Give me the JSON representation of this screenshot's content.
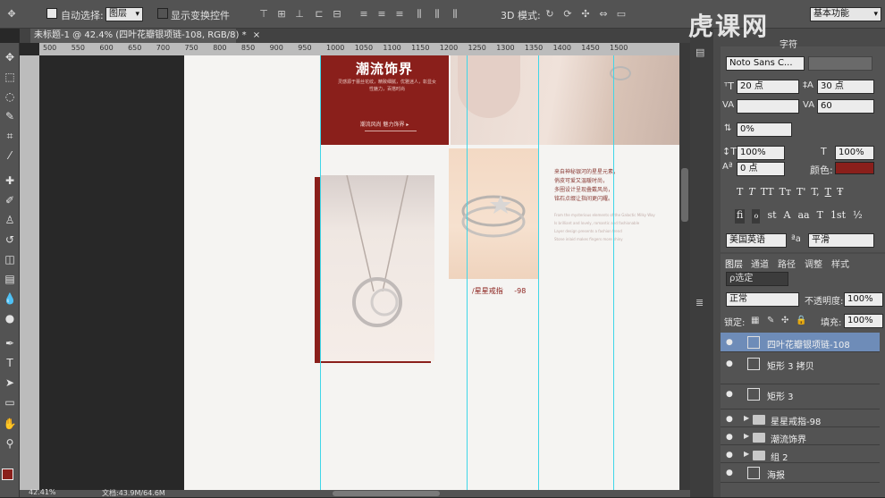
{
  "options_bar": {
    "auto_select_label": "自动选择:",
    "auto_select_value": "图层",
    "show_transform_label": "显示变换控件",
    "mode_3d_label": "3D 模式:",
    "workspace": "基本功能"
  },
  "document": {
    "tab_title": "未标题-1 @ 42.4% (四叶花瓣银项链-108, RGB/8) *",
    "tab_close": "×",
    "ruler_ticks": [
      "500",
      "550",
      "600",
      "650",
      "700",
      "750",
      "800",
      "850",
      "900",
      "950",
      "1000",
      "1050",
      "1100",
      "1150",
      "1200",
      "1250",
      "1300",
      "1350",
      "1400",
      "1450",
      "1500"
    ],
    "status_zoom": "42.41%",
    "status_doc": "文档:43.9M/64.6M"
  },
  "artboard": {
    "banner_title": "潮流饰界",
    "banner_body": "灵感源于蕾丝花纹，精致细腻，优雅迷人，彰显女性魅力，百搭时尚",
    "banner_link": "潮流风尚 魅力饰界 ▸",
    "text_block": [
      "来自神秘银河的星星元素，",
      "俏皮可爱又温暖时尚，",
      "多圈设计呈现叠戴风尚，",
      "铭石点缀让指间更闪耀。"
    ],
    "text_small": [
      "From the mysterious elements of the Galactic Milky Way",
      "Is brilliant and lovely, romantic and fashionable",
      "Layer design presents a fashion trend",
      "Stone inlaid makes fingers more shiny"
    ],
    "product_caption": "/星星戒指",
    "product_price": "-98",
    "colors": {
      "brand_red": "#8a1f1b",
      "guide": "#3fd6e8"
    }
  },
  "character_panel": {
    "tab": "字符",
    "font_family": "Noto Sans C...",
    "font_size": "20 点",
    "leading": "30 点",
    "kerning": "",
    "tracking": "60",
    "scale_percent": "0%",
    "vscale": "100%",
    "hscale": "100%",
    "baseline": "0 点",
    "color_label": "颜色:",
    "color_value": "#8a1f1b",
    "style_buttons": [
      "T",
      "T",
      "TT",
      "Tт",
      "T'",
      "T,",
      "T",
      "Ŧ"
    ],
    "ligature_buttons": [
      "ﬁ",
      "ℴ",
      "st",
      "A",
      "aa",
      "T",
      "1st",
      "½"
    ],
    "language": "美国英语",
    "aa_label": "ªa",
    "antialias": "平滑"
  },
  "layers_panel": {
    "tabs": [
      "图层",
      "通道",
      "路径",
      "调整",
      "样式"
    ],
    "filter": "ρ选定",
    "blend_mode": "正常",
    "opacity_label": "不透明度:",
    "opacity": "100%",
    "lock_label": "锁定:",
    "fill_label": "填充:",
    "fill": "100%",
    "layers": [
      {
        "name": "四叶花瓣银项链-108",
        "kind": "smart",
        "selected": true
      },
      {
        "name": "矩形 3 拷贝",
        "kind": "shape",
        "selected": false
      },
      {
        "name": "矩形 3",
        "kind": "shape",
        "selected": false
      },
      {
        "name": "星星戒指-98",
        "kind": "group",
        "selected": false
      },
      {
        "name": "潮流饰界",
        "kind": "group",
        "selected": false
      },
      {
        "name": "组 2",
        "kind": "group",
        "selected": false
      },
      {
        "name": "海报",
        "kind": "smart",
        "selected": false
      }
    ]
  },
  "watermark": "虎课网"
}
